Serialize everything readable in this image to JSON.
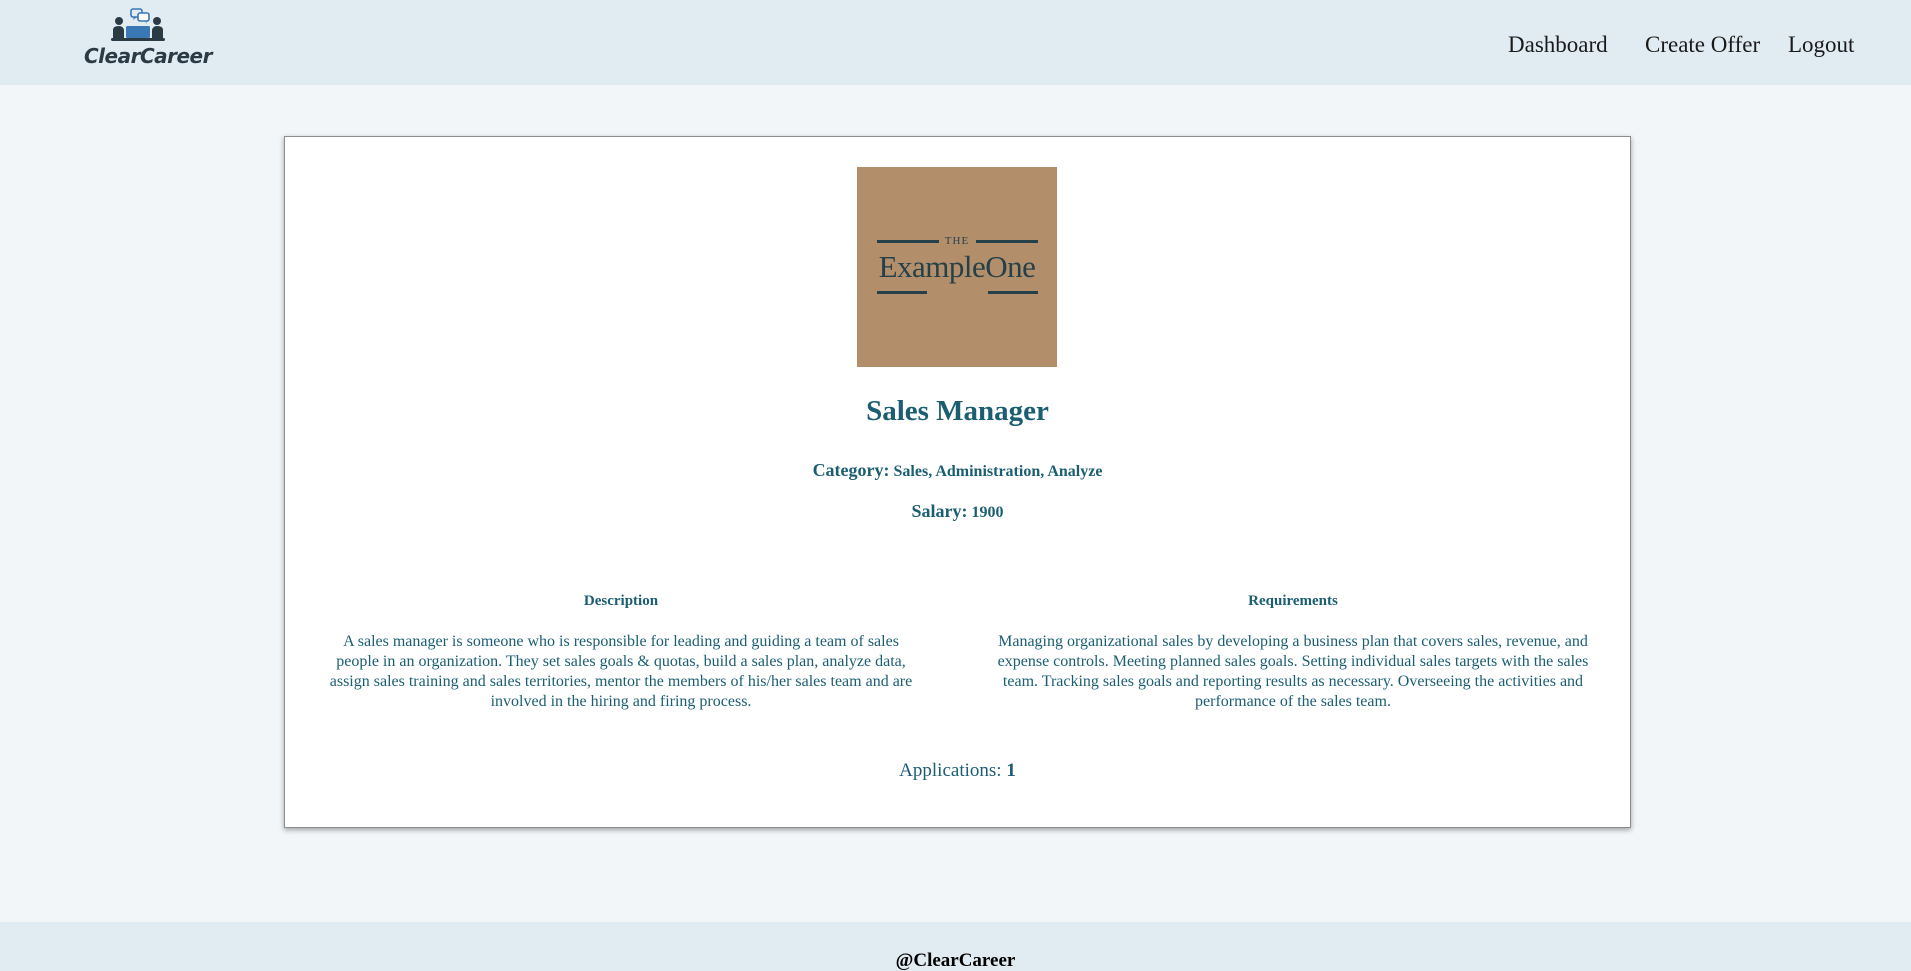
{
  "brand": {
    "name": "ClearCareer",
    "icon": "people-chat-icon"
  },
  "nav": {
    "items": [
      {
        "label": "Dashboard"
      },
      {
        "label": "Create Offer"
      },
      {
        "label": "Logout"
      }
    ]
  },
  "offer": {
    "company_logo": {
      "the": "THE",
      "name": "ExampleOne",
      "background_color": "#b28f6a"
    },
    "title": "Sales Manager",
    "category_label": "Category:",
    "category_value": "Sales, Administration, Analyze",
    "salary_label": "Salary:",
    "salary_value": "1900",
    "description_title": "Description",
    "description_text": "A sales manager is someone who is responsible for leading and guiding a team of sales people in an organization. They set sales goals & quotas, build a sales plan, analyze data, assign sales training and sales territories, mentor the members of his/her sales team and are involved in the hiring and firing process.",
    "requirements_title": "Requirements",
    "requirements_text": "Managing organizational sales by developing a business plan that covers sales, revenue, and expense controls. Meeting planned sales goals. Setting individual sales targets with the sales team. Tracking sales goals and reporting results as necessary. Overseeing the activities and performance of the sales team.",
    "applications_label": "Applications:",
    "applications_count": "1"
  },
  "footer": {
    "text": "@ClearCareer"
  },
  "colors": {
    "header_bg": "#e1ebf2",
    "page_bg": "#f2f6f8",
    "accent_text": "#1b5e72",
    "brand_blue": "#3a78b5"
  }
}
